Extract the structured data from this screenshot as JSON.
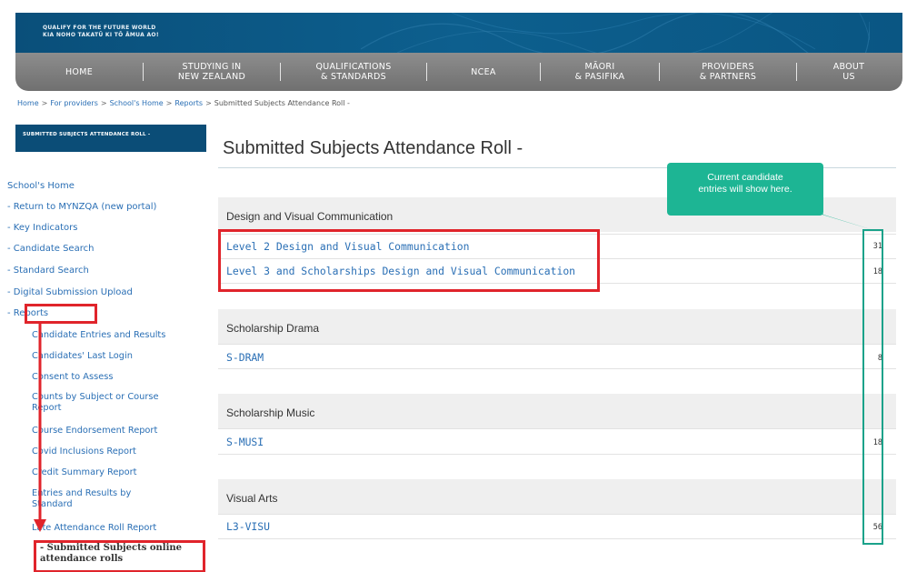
{
  "banner": {
    "tagline_line1": "QUALIFY FOR THE FUTURE WORLD",
    "tagline_line2": "KIA NOHO TAKATŪ KI TŌ ĀMUA AO!"
  },
  "nav": {
    "items": [
      {
        "line1": "HOME",
        "line2": ""
      },
      {
        "line1": "STUDYING IN",
        "line2": "NEW ZEALAND"
      },
      {
        "line1": "QUALIFICATIONS",
        "line2": "& STANDARDS"
      },
      {
        "line1": "NCEA",
        "line2": ""
      },
      {
        "line1": "MĀORI",
        "line2": "& PASIFIKA"
      },
      {
        "line1": "PROVIDERS",
        "line2": "& PARTNERS"
      },
      {
        "line1": "ABOUT",
        "line2": "US"
      }
    ]
  },
  "breadcrumb": {
    "items": [
      "Home",
      "For providers",
      "School's Home",
      "Reports"
    ],
    "current": "Submitted Subjects Attendance Roll -"
  },
  "sidebar": {
    "header": "SUBMITTED SUBJECTS ATTENDANCE ROLL -",
    "links": [
      "School's Home",
      "- Return to MYNZQA (new portal)",
      "- Key Indicators",
      "- Candidate Search",
      "- Standard Search",
      "- Digital Submission Upload",
      "- Reports"
    ],
    "report_items": [
      "Candidate Entries and Results",
      "Candidates' Last Login",
      "Consent to Assess",
      "Counts by Subject or Course Report",
      "Course Endorsement Report",
      "Covid Inclusions Report",
      "Credit Summary Report",
      "Entries and Results by Standard",
      "Late Attendance Roll Report"
    ],
    "current_item": "- Submitted Subjects online attendance rolls"
  },
  "main": {
    "title": "Submitted Subjects Attendance Roll -",
    "groups": [
      {
        "name": "Design and Visual Communication",
        "rows": [
          {
            "label": "Level 2 Design and Visual Communication",
            "count": "31"
          },
          {
            "label": "Level 3 and Scholarships Design and Visual Communication",
            "count": "18"
          }
        ]
      },
      {
        "name": "Scholarship Drama",
        "rows": [
          {
            "label": "S-DRAM",
            "count": "8"
          }
        ]
      },
      {
        "name": "Scholarship Music",
        "rows": [
          {
            "label": "S-MUSI",
            "count": "18"
          }
        ]
      },
      {
        "name": "Visual Arts",
        "rows": [
          {
            "label": "L3-VISU",
            "count": "56"
          }
        ]
      }
    ]
  },
  "callout": {
    "line1": "Current candidate",
    "line2": "entries will show here."
  },
  "colors": {
    "banner": "#0b4d77",
    "nav": "#7a7a7a",
    "link": "#2a6fb5",
    "highlight_red": "#e0242b",
    "callout_green": "#1db594"
  }
}
